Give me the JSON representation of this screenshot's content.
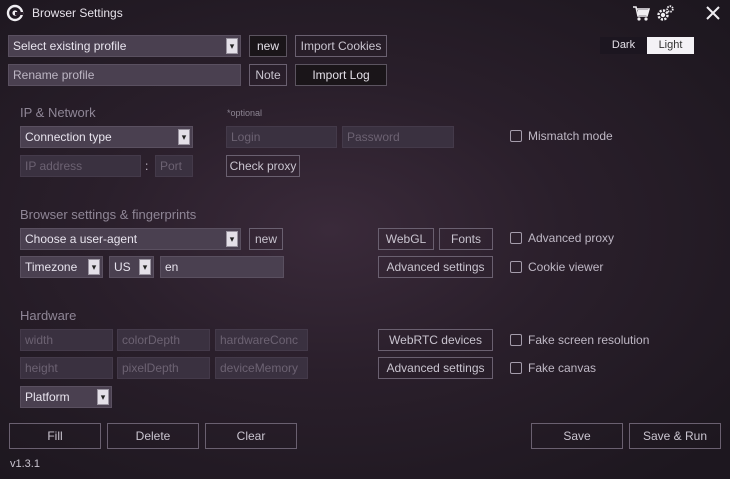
{
  "window": {
    "title": "Browser Settings",
    "icons": [
      "app-logo-icon",
      "cart-icon",
      "gear-icon",
      "close-icon"
    ]
  },
  "profile": {
    "select_value": "Select existing profile",
    "new_button": "new",
    "import_cookies_button": "Import Cookies",
    "rename_value": "Rename profile",
    "note_button": "Note",
    "import_log_button": "Import Log"
  },
  "theme": {
    "dark_label": "Dark",
    "light_label": "Light",
    "selected": "Light"
  },
  "network": {
    "section_title": "IP & Network",
    "optional_note": "*optional",
    "connection_type": "Connection type",
    "login_placeholder": "Login",
    "password_placeholder": "Password",
    "ip_placeholder": "IP address",
    "colon": ":",
    "port_placeholder": "Port",
    "check_proxy_button": "Check proxy",
    "mismatch_label": "Mismatch mode"
  },
  "browser": {
    "section_title": "Browser settings & fingerprints",
    "user_agent": "Choose a user-agent",
    "new_button": "new",
    "webgl_button": "WebGL",
    "fonts_button": "Fonts",
    "advanced_proxy_label": "Advanced proxy",
    "timezone": "Timezone",
    "country": "US",
    "language": "en",
    "advanced_settings_button": "Advanced settings",
    "cookie_viewer_label": "Cookie viewer"
  },
  "hardware": {
    "section_title": "Hardware",
    "width_placeholder": "width",
    "color_depth_placeholder": "colorDepth",
    "hardware_conc_placeholder": "hardwareConc",
    "height_placeholder": "height",
    "pixel_depth_placeholder": "pixelDepth",
    "device_memory_placeholder": "deviceMemory",
    "platform": "Platform",
    "webrtc_button": "WebRTC devices",
    "advanced_settings_button": "Advanced settings",
    "fake_resolution_label": "Fake screen resolution",
    "fake_canvas_label": "Fake canvas"
  },
  "footer": {
    "fill_button": "Fill",
    "delete_button": "Delete",
    "clear_button": "Clear",
    "save_button": "Save",
    "save_run_button": "Save & Run",
    "version": "v1.3.1"
  }
}
